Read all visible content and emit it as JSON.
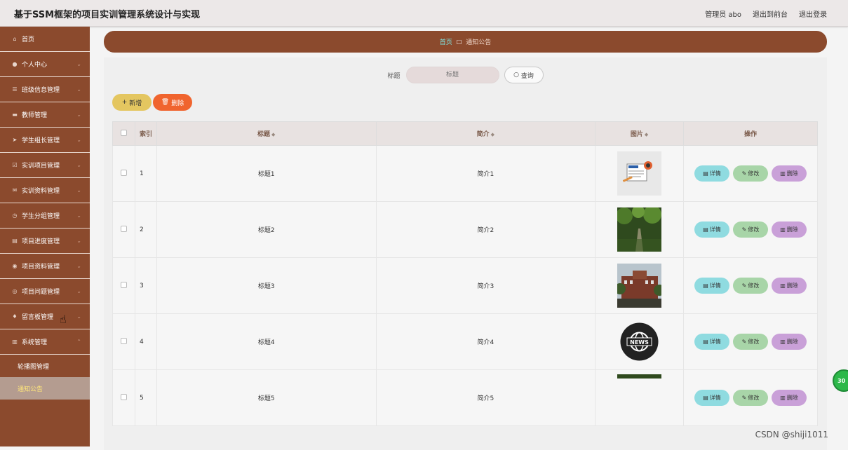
{
  "header": {
    "app_title": "基于SSM框架的项目实训管理系统设计与实现",
    "admin_label": "管理员 abo",
    "exit_front": "退出到前台",
    "logout": "退出登录"
  },
  "sidebar": {
    "items": [
      {
        "label": "首页",
        "icon": "home-icon"
      },
      {
        "label": "个人中心",
        "icon": "user-icon"
      },
      {
        "label": "班级信息管理",
        "icon": "list-icon"
      },
      {
        "label": "教师管理",
        "icon": "id-card-icon"
      },
      {
        "label": "学生组长管理",
        "icon": "send-icon"
      },
      {
        "label": "实训项目管理",
        "icon": "check-box-icon"
      },
      {
        "label": "实训资料管理",
        "icon": "mail-icon"
      },
      {
        "label": "学生分组管理",
        "icon": "clock-icon"
      },
      {
        "label": "项目进度管理",
        "icon": "doc-icon"
      },
      {
        "label": "项目资料管理",
        "icon": "pin-icon"
      },
      {
        "label": "项目问题管理",
        "icon": "compass-icon"
      },
      {
        "label": "留言板管理",
        "icon": "bulb-icon"
      },
      {
        "label": "系统管理",
        "icon": "chart-icon"
      }
    ],
    "sub_items": [
      {
        "label": "轮播图管理"
      },
      {
        "label": "通知公告"
      }
    ]
  },
  "breadcrumb": {
    "home": "首页",
    "current": "通知公告"
  },
  "search": {
    "label": "标题",
    "placeholder": "标题",
    "button": "查询"
  },
  "actions": {
    "add": "新增",
    "delete": "删除"
  },
  "table": {
    "headers": {
      "index": "索引",
      "title": "标题",
      "intro": "简介",
      "image": "图片",
      "ops": "操作"
    },
    "rows": [
      {
        "index": "1",
        "title": "标题1",
        "intro": "简介1",
        "image": "news-illustration"
      },
      {
        "index": "2",
        "title": "标题2",
        "intro": "简介2",
        "image": "tree-path-photo"
      },
      {
        "index": "3",
        "title": "标题3",
        "intro": "简介3",
        "image": "campus-building-photo"
      },
      {
        "index": "4",
        "title": "标题4",
        "intro": "简介4",
        "image": "news-globe-logo"
      },
      {
        "index": "5",
        "title": "标题5",
        "intro": "简介5",
        "image": "partial-photo"
      }
    ],
    "op_labels": {
      "detail": "详情",
      "edit": "修改",
      "delete": "删除"
    }
  },
  "overlay": {
    "watermark": "CSDN @shiji1011",
    "float_badge": "30"
  },
  "colors": {
    "sidebar_bg": "#8b4a2d",
    "accent_home": "#7fe3e0",
    "add_btn": "#e4c660",
    "del_btn": "#f0642e",
    "detail_btn": "#8fdbe0",
    "edit_btn": "#a8d5a8",
    "delete_op_btn": "#c9a0d8"
  }
}
